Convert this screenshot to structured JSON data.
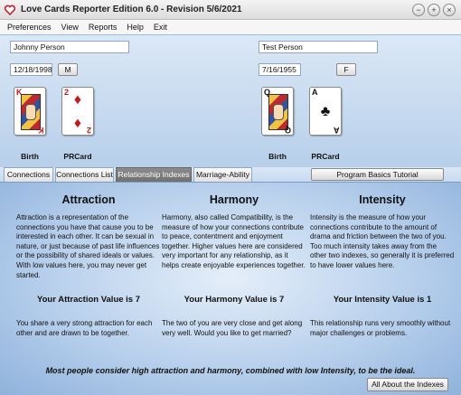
{
  "window": {
    "title": "Love Cards Reporter Edition 6.0  -  Revision 5/6/2021",
    "controls": [
      "−",
      "+",
      "×"
    ]
  },
  "menu": [
    "Preferences",
    "View",
    "Reports",
    "Help",
    "Exit"
  ],
  "person1": {
    "name": "Johnny Person",
    "birthdate": "12/18/1998",
    "gender": "M",
    "birth_card": {
      "rank": "K",
      "suit": "♦",
      "color": "red"
    },
    "prcard": {
      "rank": "2",
      "suit": "♦",
      "color": "red"
    },
    "birth_label": "Birth",
    "prcard_label": "PRCard"
  },
  "person2": {
    "name": "Test Person",
    "birthdate": "7/16/1955",
    "gender": "F",
    "birth_card": {
      "rank": "Q",
      "suit": "♣",
      "color": "black"
    },
    "prcard": {
      "rank": "A",
      "suit": "♣",
      "color": "black"
    },
    "birth_label": "Birth",
    "prcard_label": "PRCard"
  },
  "tabs": [
    "Connections",
    "Connections List",
    "Relationship Indexes",
    "Marriage-Ability"
  ],
  "active_tab": "Relationship Indexes",
  "tutorial_button": "Program Basics Tutorial",
  "columns": {
    "attraction": {
      "title": "Attraction",
      "description": "Attraction is a representation of the connections you have that cause you to be interested in each other. It can be sexual in nature, or just because of past life influences or the possibility of shared ideals or values. With low values here, you may never get started.",
      "value": "Your Attraction Value is 7",
      "result": "You share a very strong attraction for each other and are drawn to be together."
    },
    "harmony": {
      "title": "Harmony",
      "description": "Harmony, also called Compatibility, is the measure of how your connections contribute to peace, contentment and enjoyment together. Higher values here are considered very important for any relationship, as it helps create enjoyable experiences together.",
      "value": "Your Harmony Value is 7",
      "result": "The two of you are very close and get along very well. Would you like to get married?"
    },
    "intensity": {
      "title": "Intensity",
      "description": "Intensity is the measure of how your connections contribute to the amount of drama and friction between the two of you. Too much intensity takes away from the other two indexes, so generally it is preferred to have lower values here.",
      "value": "Your Intensity Value is 1",
      "result": "This relationship runs very smoothly without major challenges or problems."
    }
  },
  "footer_note": "Most people consider high attraction and harmony, combined with low Intensity, to be the ideal.",
  "indexes_button": "All About the Indexes",
  "colors": {
    "accent_blue": "#b7cfea",
    "card_red": "#d0121b"
  }
}
